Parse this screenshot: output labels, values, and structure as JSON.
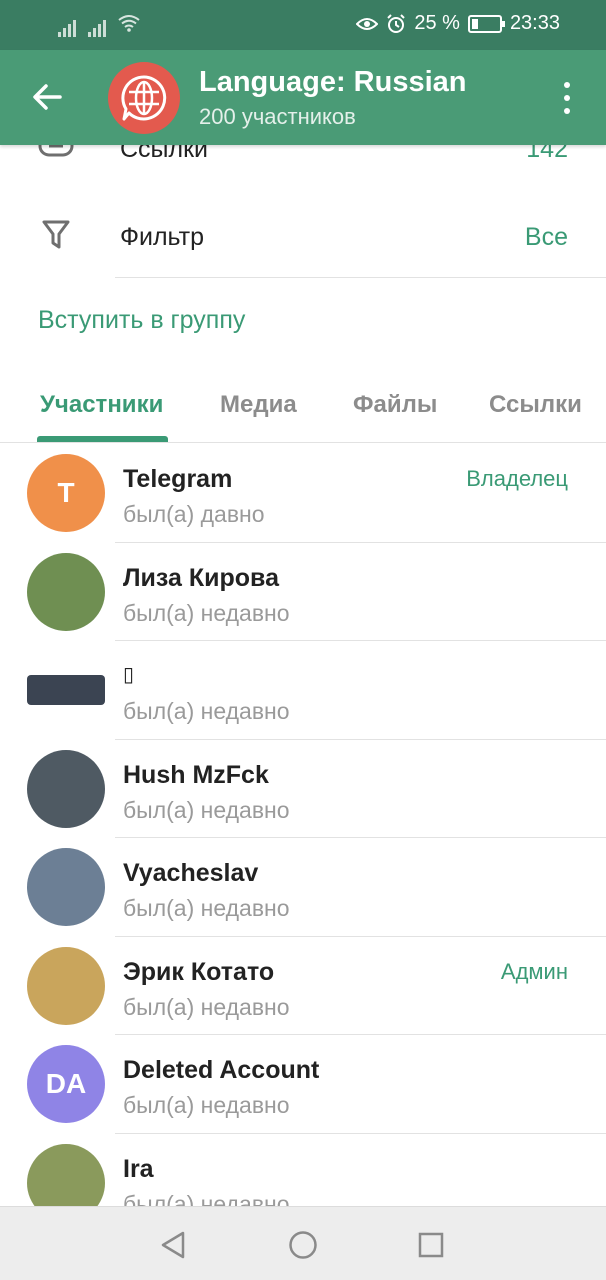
{
  "status_bar": {
    "battery": "25 %",
    "battery_level": 0.25,
    "time": "23:33",
    "icons": [
      "signal-icon",
      "signal-icon",
      "wifi-icon",
      "eye-icon",
      "alarm-icon",
      "battery-icon"
    ]
  },
  "header": {
    "title": "Language: Russian",
    "subtitle": "200 участников",
    "avatar_color": "#e35a4e",
    "avatar_icon": "globe-chat-icon"
  },
  "settings": {
    "links_label": "Ссылки",
    "links_value": "142",
    "filter_label": "Фильтр",
    "filter_value": "Все",
    "join_label": "Вступить в группу"
  },
  "tabs": [
    "Участники",
    "Медиа",
    "Файлы",
    "Ссылки"
  ],
  "active_tab": 0,
  "members": [
    {
      "name": "Telegram",
      "status": "был(а) давно",
      "role": "Владелец",
      "initials": "T",
      "color": "#f0904a"
    },
    {
      "name": "Лиза Кирова",
      "status": "был(а) недавно",
      "role": "",
      "initials": "",
      "color": "#6f8f52"
    },
    {
      "name": "▯",
      "status": "был(а) недавно",
      "role": "",
      "initials": "",
      "color": "#3b4452"
    },
    {
      "name": "Hush MzFck",
      "status": "был(а) недавно",
      "role": "",
      "initials": "",
      "color": "#4f5a63"
    },
    {
      "name": "Vyacheslav",
      "status": "был(а) недавно",
      "role": "",
      "initials": "",
      "color": "#6c7f95"
    },
    {
      "name": "Эрик Котато",
      "status": "был(а) недавно",
      "role": "Админ",
      "initials": "",
      "color": "#c9a55c"
    },
    {
      "name": "Deleted Account",
      "status": "был(а) недавно",
      "role": "",
      "initials": "DA",
      "color": "#8f84e6"
    },
    {
      "name": "Ira",
      "status": "был(а) недавно",
      "role": "",
      "initials": "",
      "color": "#8a9a5c"
    }
  ],
  "colors": {
    "status_bar": "#3a7d62",
    "header": "#4a9b76",
    "accent": "#3a9a75"
  }
}
